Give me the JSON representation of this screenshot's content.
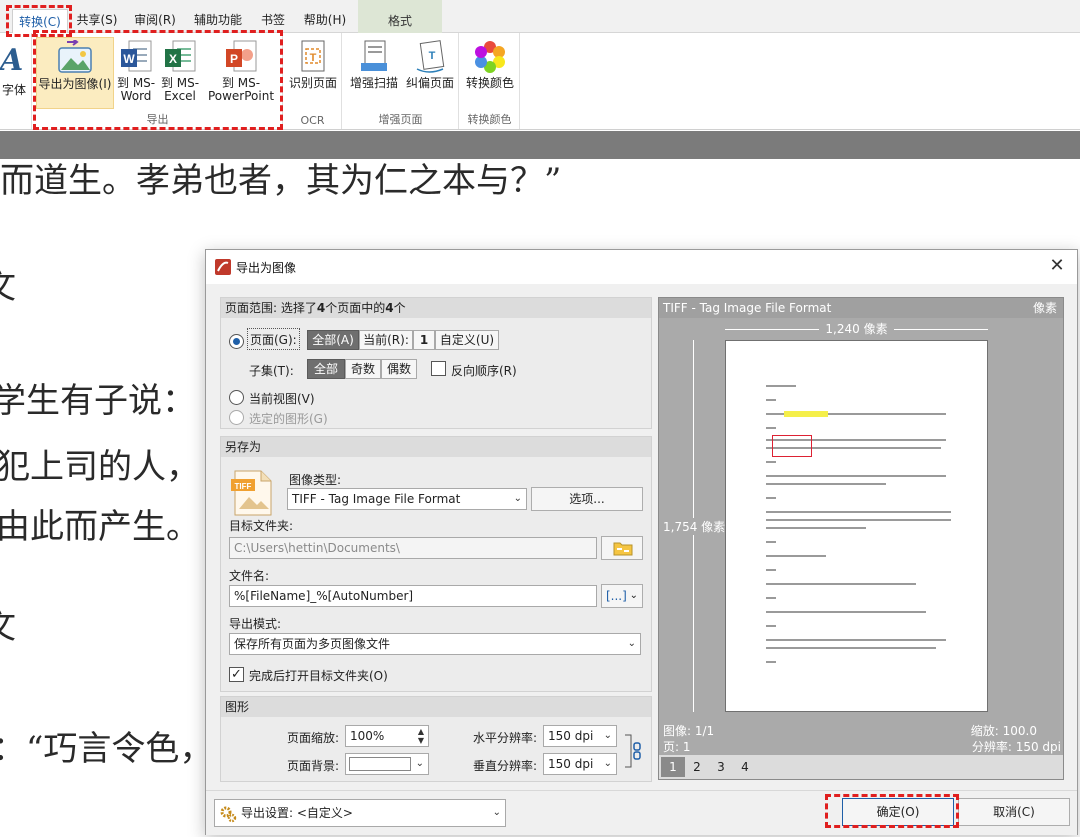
{
  "menubar": {
    "tabs": [
      "转换(C)",
      "共享(S)",
      "审阅(R)",
      "辅助功能",
      "书签",
      "帮助(H)"
    ],
    "context_tab": "格式"
  },
  "ribbon": {
    "partial_left_label": "字体",
    "export_group": {
      "label": "导出",
      "buttons": [
        {
          "line1": "导出为图像(I)",
          "line2": ""
        },
        {
          "line1": "到 MS-",
          "line2": "Word"
        },
        {
          "line1": "到 MS-",
          "line2": "Excel"
        },
        {
          "line1": "到 MS-",
          "line2": "PowerPoint"
        }
      ]
    },
    "ocr_group": {
      "label": "OCR",
      "button": "识别页面"
    },
    "enhance_group": {
      "label": "增强页面",
      "buttons": [
        "增强扫描",
        "纠偏页面"
      ]
    },
    "color_group": {
      "label": "转换颜色",
      "button": "转换颜色"
    }
  },
  "document": {
    "lines": [
      "而道生。孝弟也者，其为仁之本与？”",
      "文",
      "学生有子说：",
      "犯上司的人，",
      "由此而产生。",
      "文",
      "：“巧言令色，"
    ]
  },
  "dialog": {
    "title": "导出为图像",
    "page_range": {
      "header_prefix": "页面范围: 选择了",
      "selected": "4",
      "header_mid": "个页面中的",
      "total": "4",
      "header_suffix": "个",
      "pages_label": "页面(G):",
      "all": "全部(A)",
      "current": "当前(R):",
      "current_value": "1",
      "custom": "自定义(U)",
      "subset_label": "子集(T):",
      "subset_all": "全部",
      "subset_odd": "奇数",
      "subset_even": "偶数",
      "reverse": "反向顺序(R)",
      "current_view": "当前视图(V)",
      "selected_shapes": "选定的图形(G)"
    },
    "save_as": {
      "header": "另存为",
      "image_type_label": "图像类型:",
      "image_type_value": "TIFF - Tag Image File Format",
      "options_button": "选项...",
      "dest_folder_label": "目标文件夹:",
      "dest_folder_value": "C:\\Users\\hettin\\Documents\\",
      "filename_label": "文件名:",
      "filename_value": "%[FileName]_%[AutoNumber]",
      "macro_button": "[...]",
      "export_mode_label": "导出模式:",
      "export_mode_value": "保存所有页面为多页图像文件",
      "open_folder": "完成后打开目标文件夹(O)",
      "file_icon_text": "TIFF"
    },
    "graphics": {
      "header": "图形",
      "zoom_label": "页面缩放:",
      "zoom_value": "100%",
      "bg_label": "页面背景:",
      "hres_label": "水平分辨率:",
      "hres_value": "150 dpi",
      "vres_label": "垂直分辨率:",
      "vres_value": "150 dpi"
    },
    "preview": {
      "format": "TIFF - Tag Image File Format",
      "unit": "像素",
      "width_label": "1,240 像素",
      "height_label": "1,754 像素",
      "image_info": "图像: 1/1",
      "page_info": "页: 1",
      "zoom_info": "缩放: 100.0",
      "res_info": "分辨率: 150 dpi",
      "page_tabs": [
        "1",
        "2",
        "3",
        "4"
      ]
    },
    "footer": {
      "settings_value": "导出设置: <自定义>",
      "ok": "确定(O)",
      "cancel": "取消(C)"
    }
  },
  "colors": {
    "accent": "#1f5fa8",
    "annotation_red": "#e01f1f",
    "ribbon_highlight": "#fbecc0"
  }
}
